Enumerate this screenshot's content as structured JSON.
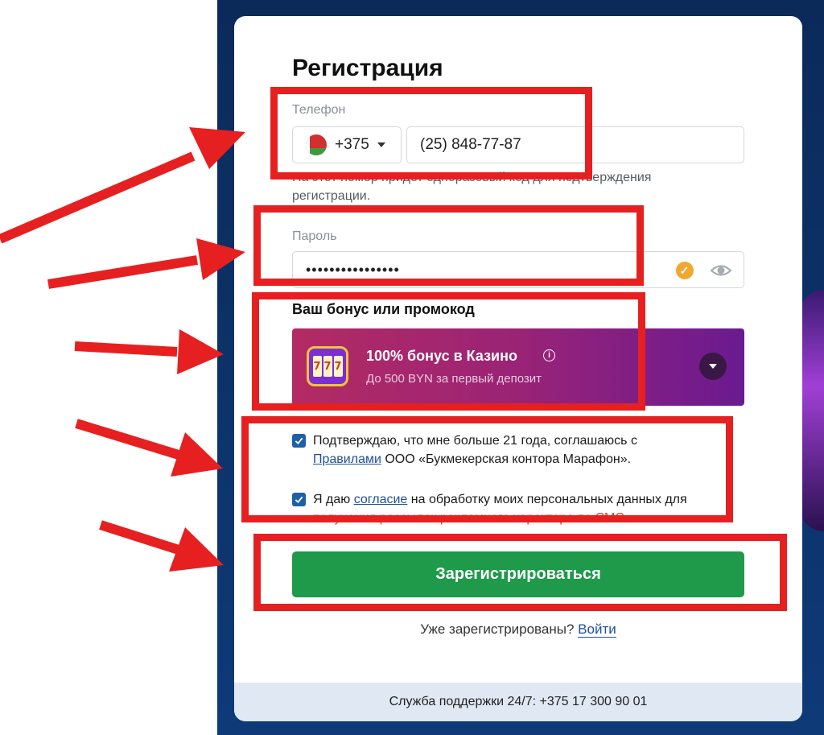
{
  "form": {
    "title": "Регистрация",
    "phone_label": "Телефон",
    "country_code": "+375",
    "phone_value": "(25) 848-77-87",
    "phone_hint": "На этот номер придет одноразовый код для подтверждения регистрации.",
    "password_label": "Пароль",
    "password_value": "••••••••••••••••",
    "bonus_heading": "Ваш бонус или промокод",
    "bonus_title": "100% бонус в Казино",
    "bonus_subtitle": "До 500 BYN за первый депозит",
    "slot_symbols": [
      "7",
      "7",
      "7"
    ],
    "check1_text_a": "Подтверждаю, что мне больше 21 года, соглашаюсь с",
    "check1_link": "Правилами",
    "check1_text_b": "ООО «Букмекерская контора Марафон».",
    "check2_text_a": "Я даю",
    "check2_link": "согласие",
    "check2_text_b": "на обработку моих персональных данных для",
    "check2_text_c": "получения рассылок рекламного характера по СМС",
    "submit_label": "Зарегистрироваться",
    "login_prompt": "Уже зарегистрированы?",
    "login_link": "Войти",
    "support": "Служба поддержки 24/7: +375 17 300 90 01"
  },
  "icons": {
    "flag": "belarus-flag-icon",
    "caret": "chevron-down-icon",
    "valid": "check-circle-icon",
    "eye": "eye-icon",
    "info": "info-icon",
    "slot": "slot-machine-icon",
    "checkbox": "checkbox-checked-icon"
  },
  "colors": {
    "submit": "#1e9a4a",
    "annotation": "#e62020",
    "link": "#1f4f99",
    "bonus_start": "#b32b63",
    "bonus_end": "#6a1a91"
  }
}
